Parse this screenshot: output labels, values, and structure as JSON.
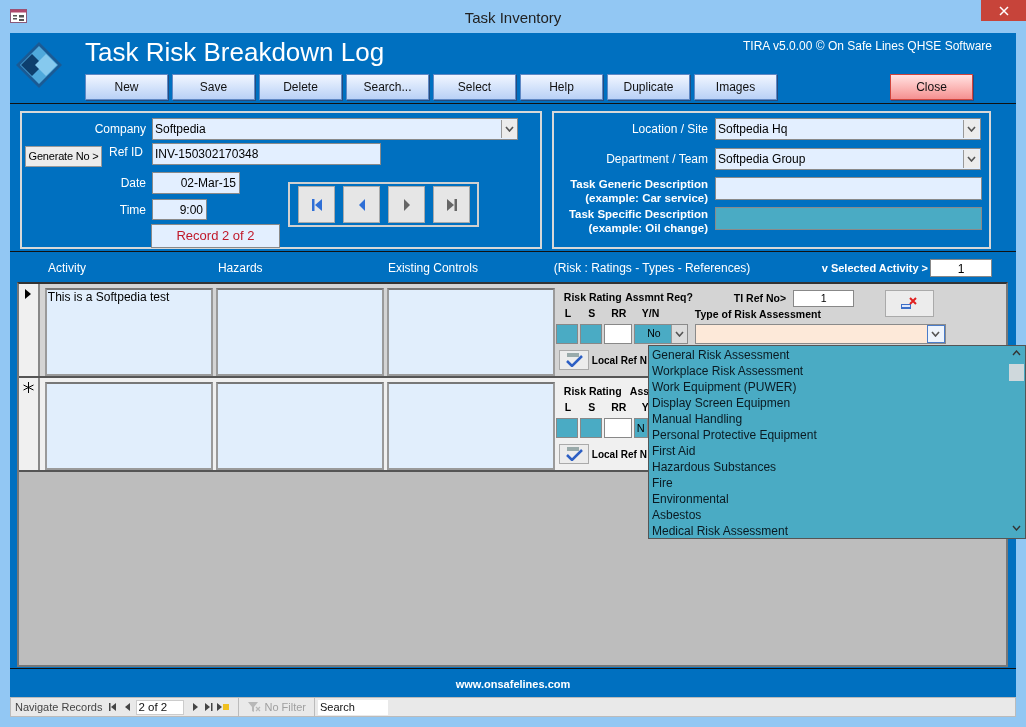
{
  "window": {
    "title": "Task Inventory"
  },
  "header": {
    "title": "Task Risk Breakdown Log",
    "version": "TIRA v5.0.00 © On Safe Lines QHSE Software",
    "buttons": [
      {
        "label": "New",
        "kind": "normal"
      },
      {
        "label": "Save",
        "kind": "normal"
      },
      {
        "label": "Delete",
        "kind": "normal"
      },
      {
        "label": "Search...",
        "kind": "normal"
      },
      {
        "label": "Select",
        "kind": "normal"
      },
      {
        "label": "Help",
        "kind": "normal"
      },
      {
        "label": "Duplicate",
        "kind": "normal"
      },
      {
        "label": "Images",
        "kind": "normal"
      },
      {
        "label": "Close",
        "kind": "close"
      }
    ]
  },
  "left_panel": {
    "company": {
      "label": "Company",
      "value": "Softpedia"
    },
    "generate_button": "Generate No >",
    "ref_id": {
      "label": "Ref ID",
      "value": "INV-150302170348"
    },
    "date": {
      "label": "Date",
      "value": "02-Mar-15"
    },
    "time": {
      "label": "Time",
      "value": "9:00"
    },
    "record_status": "Record 2 of 2",
    "nav_buttons": [
      {
        "kind": "first"
      },
      {
        "kind": "previous"
      },
      {
        "kind": "next"
      },
      {
        "kind": "last"
      }
    ]
  },
  "right_panel": {
    "location": {
      "label": "Location / Site",
      "value": "Softpedia Hq"
    },
    "department": {
      "label": "Department / Team",
      "value": "Softpedia Group"
    },
    "descriptions": [
      {
        "label": "Task Generic Description",
        "example": "(example: Car service)",
        "highlighted": false
      },
      {
        "label": "Task Specific Description",
        "example": "(example: Oil change)",
        "highlighted": true
      }
    ]
  },
  "columns": [
    "Activity",
    "Hazards",
    "Existing Controls",
    "(Risk : Ratings - Types - References)"
  ],
  "selected_activity": {
    "label": "v Selected Activity >",
    "value": "1"
  },
  "rows": [
    {
      "kind": "current",
      "activity": "This is a Softpedia test",
      "risk_rating_label": "Risk Rating",
      "assessment_label": "Assmnt Req?",
      "l_label": "L",
      "s_label": "S",
      "rr_label": "RR",
      "yn_label": "Y/N",
      "yn_value": "No",
      "ti_ref_label": "TI Ref No>",
      "ti_ref_value": "1",
      "type_label": "Type of Risk Assessment",
      "local_ref_label": "Local Ref N"
    },
    {
      "kind": "new",
      "risk_rating_label": "Risk Rating",
      "assessment_label": "Ass",
      "l_label": "L",
      "s_label": "S",
      "rr_label": "RR",
      "yn_label": "Y",
      "yn_value": "N",
      "local_ref_label": "Local Ref N"
    }
  ],
  "dropdown": {
    "items": [
      "General Risk Assessment",
      "Workplace Risk Assessment",
      "Work Equipment (PUWER)",
      "Display Screen Equipmen",
      "Manual Handling",
      "Personal Protective Equipment",
      "First Aid",
      "Hazardous Substances",
      "Fire",
      "Environmental",
      "Asbestos",
      "Medical Risk Assessment"
    ]
  },
  "footer": {
    "url": "www.onsafelines.com"
  },
  "navigation": {
    "label": "Navigate Records",
    "position": "2 of 2",
    "filter": "No Filter",
    "filter_disabled": true,
    "search_placeholder": "Search"
  }
}
